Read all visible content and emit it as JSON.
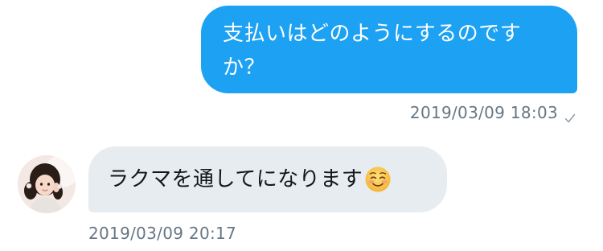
{
  "conversation": {
    "messages": [
      {
        "direction": "outgoing",
        "text": "支払いはどのようにするのですか？",
        "timestamp": "2019/03/09 18:03",
        "status_icon": "check-icon"
      },
      {
        "direction": "incoming",
        "text": "ラクマを通してになります",
        "emoji": "smiling-face-icon",
        "timestamp": "2019/03/09 20:17",
        "avatar": "avatar"
      }
    ]
  },
  "colors": {
    "outgoing_bubble": "#1da1f2",
    "incoming_bubble": "#e6ecf0",
    "timestamp": "#657786"
  }
}
